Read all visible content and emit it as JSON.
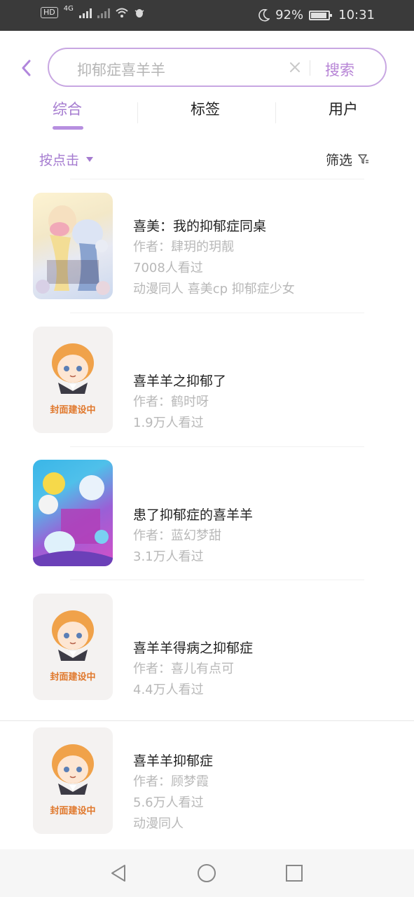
{
  "status_bar": {
    "network_badge": "HD",
    "network_type": "4G",
    "battery_percent": "92%",
    "battery_level": 0.92,
    "time": "10:31",
    "icons": [
      "hd-icon",
      "signal-icon",
      "wifi-icon",
      "bug-icon",
      "moon-icon",
      "battery-icon"
    ]
  },
  "search": {
    "query": "抑郁症喜羊羊",
    "button_label": "搜索"
  },
  "tabs": [
    {
      "label": "综合",
      "active": true
    },
    {
      "label": "标签",
      "active": false
    },
    {
      "label": "用户",
      "active": false
    }
  ],
  "sort": {
    "label": "按点击"
  },
  "filter": {
    "label": "筛选"
  },
  "results": [
    {
      "title": "喜美：我的抑郁症同桌",
      "author": "作者：肆玥的玥靓",
      "views": "7008人看过",
      "tags": "动漫同人  喜美cp  抑郁症少女",
      "cover": "illustration"
    },
    {
      "title": "喜羊羊之抑郁了",
      "author": "作者：鹤时呀",
      "views": "1.9万人看过",
      "tags": "",
      "cover": "placeholder"
    },
    {
      "title": "患了抑郁症的喜羊羊",
      "author": "作者：蓝幻梦甜",
      "views": "3.1万人看过",
      "tags": "",
      "cover": "illustration"
    },
    {
      "title": "喜羊羊得病之抑郁症",
      "author": "作者：喜儿有点可",
      "views": "4.4万人看过",
      "tags": "",
      "cover": "placeholder"
    },
    {
      "title": "喜羊羊抑郁症",
      "author": "作者：顾梦霞",
      "views": "5.6万人看过",
      "tags": "动漫同人",
      "cover": "placeholder"
    }
  ],
  "placeholder_cover_text": "封面建设中",
  "colors": {
    "accent": "#a57bd0",
    "search_border": "#c8a7e2",
    "placeholder_text": "#e0782c",
    "meta_text": "#b8b8b8"
  }
}
